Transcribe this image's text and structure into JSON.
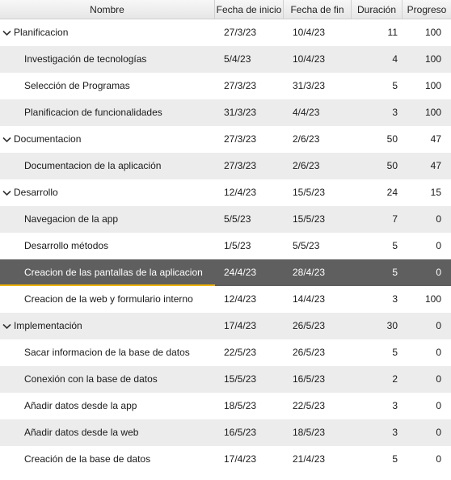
{
  "columns": {
    "name": "Nombre",
    "start": "Fecha de inicio",
    "end": "Fecha de fin",
    "duration": "Duración",
    "progress": "Progreso"
  },
  "colors": {
    "header_bg": "#e9e9e9",
    "alt_row": "#ececec",
    "selected_row": "#5f5f5f",
    "selected_accent": "#f0b400"
  },
  "tasks": [
    {
      "name": "Planificacion",
      "start": "27/3/23",
      "end": "10/4/23",
      "duration": "11",
      "progress": "100",
      "level": 0,
      "expanded": true,
      "icon": "chevron-down-icon"
    },
    {
      "name": "Investigación de tecnologías",
      "start": "5/4/23",
      "end": "10/4/23",
      "duration": "4",
      "progress": "100",
      "level": 1
    },
    {
      "name": "Selección de Programas",
      "start": "27/3/23",
      "end": "31/3/23",
      "duration": "5",
      "progress": "100",
      "level": 1
    },
    {
      "name": "Planificacion de funcionalidades",
      "start": "31/3/23",
      "end": "4/4/23",
      "duration": "3",
      "progress": "100",
      "level": 1
    },
    {
      "name": "Documentacion",
      "start": "27/3/23",
      "end": "2/6/23",
      "duration": "50",
      "progress": "47",
      "level": 0,
      "expanded": true,
      "icon": "chevron-down-icon"
    },
    {
      "name": "Documentacion de la aplicación",
      "start": "27/3/23",
      "end": "2/6/23",
      "duration": "50",
      "progress": "47",
      "level": 1
    },
    {
      "name": "Desarrollo",
      "start": "12/4/23",
      "end": "15/5/23",
      "duration": "24",
      "progress": "15",
      "level": 0,
      "expanded": true,
      "icon": "chevron-down-icon"
    },
    {
      "name": "Navegacion de la app",
      "start": "5/5/23",
      "end": "15/5/23",
      "duration": "7",
      "progress": "0",
      "level": 1
    },
    {
      "name": "Desarrollo métodos",
      "start": "1/5/23",
      "end": "5/5/23",
      "duration": "5",
      "progress": "0",
      "level": 1
    },
    {
      "name": "Creacion de las pantallas de la aplicacion",
      "start": "24/4/23",
      "end": "28/4/23",
      "duration": "5",
      "progress": "0",
      "level": 1,
      "selected": true
    },
    {
      "name": "Creacion de la web y formulario interno",
      "start": "12/4/23",
      "end": "14/4/23",
      "duration": "3",
      "progress": "100",
      "level": 1
    },
    {
      "name": "Implementación",
      "start": "17/4/23",
      "end": "26/5/23",
      "duration": "30",
      "progress": "0",
      "level": 0,
      "expanded": true,
      "icon": "chevron-down-icon"
    },
    {
      "name": "Sacar informacion de la base de datos",
      "start": "22/5/23",
      "end": "26/5/23",
      "duration": "5",
      "progress": "0",
      "level": 1
    },
    {
      "name": "Conexión con la base de datos",
      "start": "15/5/23",
      "end": "16/5/23",
      "duration": "2",
      "progress": "0",
      "level": 1
    },
    {
      "name": "Añadir datos desde la app",
      "start": "18/5/23",
      "end": "22/5/23",
      "duration": "3",
      "progress": "0",
      "level": 1
    },
    {
      "name": "Añadir datos desde la web",
      "start": "16/5/23",
      "end": "18/5/23",
      "duration": "3",
      "progress": "0",
      "level": 1
    },
    {
      "name": "Creación de la base de datos",
      "start": "17/4/23",
      "end": "21/4/23",
      "duration": "5",
      "progress": "0",
      "level": 1
    }
  ]
}
